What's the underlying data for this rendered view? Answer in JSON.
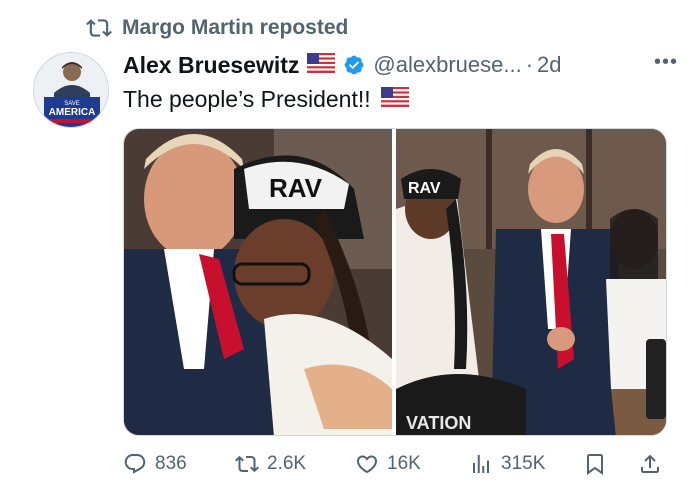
{
  "repost": {
    "label": "Margo Martin reposted",
    "icon": "repost-icon"
  },
  "author": {
    "name": "Alex Bruesewitz",
    "flag": "US flag",
    "handle": "@alexbruese...",
    "separator": "·",
    "time": "2d",
    "avatar_text": {
      "line1": "SAVE",
      "line2": "AMERICA"
    }
  },
  "post": {
    "text": "The people’s President!!",
    "flag": "US flag"
  },
  "media": {
    "photos": [
      "photo-1",
      "photo-2"
    ],
    "hat_text_left": "RAV",
    "hat_text_right": "RAV",
    "hat_text_bottom": "VATION"
  },
  "actions": {
    "replies": "836",
    "reposts": "2.6K",
    "likes": "16K",
    "views": "315K"
  },
  "colors": {
    "verified": "#1d9bf0",
    "secondary_text": "#536471",
    "primary_text": "#0f1419"
  }
}
